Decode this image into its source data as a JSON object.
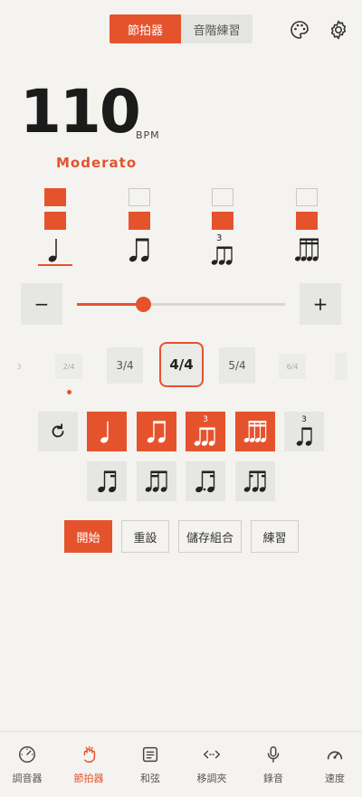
{
  "tabs": [
    {
      "label": "節拍器",
      "active": true
    },
    {
      "label": "音階練習",
      "active": false
    }
  ],
  "header_icons": [
    "palette-icon",
    "settings-gear-icon"
  ],
  "tempo": {
    "bpm": "110",
    "unit": "BPM",
    "name": "Moderato"
  },
  "beats": [
    {
      "accent": true,
      "note": "quarter-note-icon",
      "selected": true
    },
    {
      "accent": false,
      "note": "eighth-notes-icon",
      "selected": false
    },
    {
      "accent": false,
      "note": "triplet-icon",
      "triplet_label": "3",
      "selected": false
    },
    {
      "accent": false,
      "note": "sixteenth-notes-icon",
      "selected": false
    }
  ],
  "slider": {
    "minus_label": "−",
    "plus_label": "+",
    "value_fraction": 0.32
  },
  "time_signatures": [
    "3",
    "2/4",
    "3/4",
    "4/4",
    "5/4",
    "6/4",
    ""
  ],
  "time_signature_selected": "4/4",
  "patterns": {
    "row1": [
      {
        "name": "reset-pattern",
        "icon": "rotate-icon",
        "on": false
      },
      {
        "name": "quarter",
        "icon": "quarter-note-icon",
        "on": true
      },
      {
        "name": "eighths",
        "icon": "eighth-notes-icon",
        "on": true
      },
      {
        "name": "triplet",
        "icon": "triplet-icon",
        "label": "3",
        "on": true
      },
      {
        "name": "sixteenths",
        "icon": "sixteenth-notes-icon",
        "on": true
      },
      {
        "name": "triplet-rest",
        "icon": "triplet-rest-icon",
        "label": "3",
        "on": false
      }
    ],
    "row2": [
      {
        "name": "eighth-sixteenths",
        "icon": "eighth-two-sixteenths-icon",
        "on": false
      },
      {
        "name": "sixteenths-eighth",
        "icon": "two-sixteenths-eighth-icon",
        "on": false
      },
      {
        "name": "dotted-eighth-sixteenth",
        "icon": "dotted-eighth-sixteenth-icon",
        "on": false
      },
      {
        "name": "sixteenth-eighth-sixteenth",
        "icon": "sixteenth-eighth-sixteenth-icon",
        "on": false
      }
    ]
  },
  "actions": [
    {
      "label": "開始",
      "primary": true
    },
    {
      "label": "重設",
      "primary": false
    },
    {
      "label": "儲存組合",
      "primary": false
    },
    {
      "label": "練習",
      "primary": false
    }
  ],
  "nav": [
    {
      "label": "調音器",
      "icon": "tuner-dial-icon",
      "active": false
    },
    {
      "label": "節拍器",
      "icon": "metronome-hand-icon",
      "active": true
    },
    {
      "label": "和弦",
      "icon": "chord-list-icon",
      "active": false
    },
    {
      "label": "移調夾",
      "icon": "capo-arrows-icon",
      "active": false
    },
    {
      "label": "錄音",
      "icon": "microphone-icon",
      "active": false
    },
    {
      "label": "速度",
      "icon": "speedometer-icon",
      "active": false
    }
  ],
  "colors": {
    "accent": "#e5532d",
    "background": "#f4f3ef",
    "button": "#e6e6e2"
  }
}
